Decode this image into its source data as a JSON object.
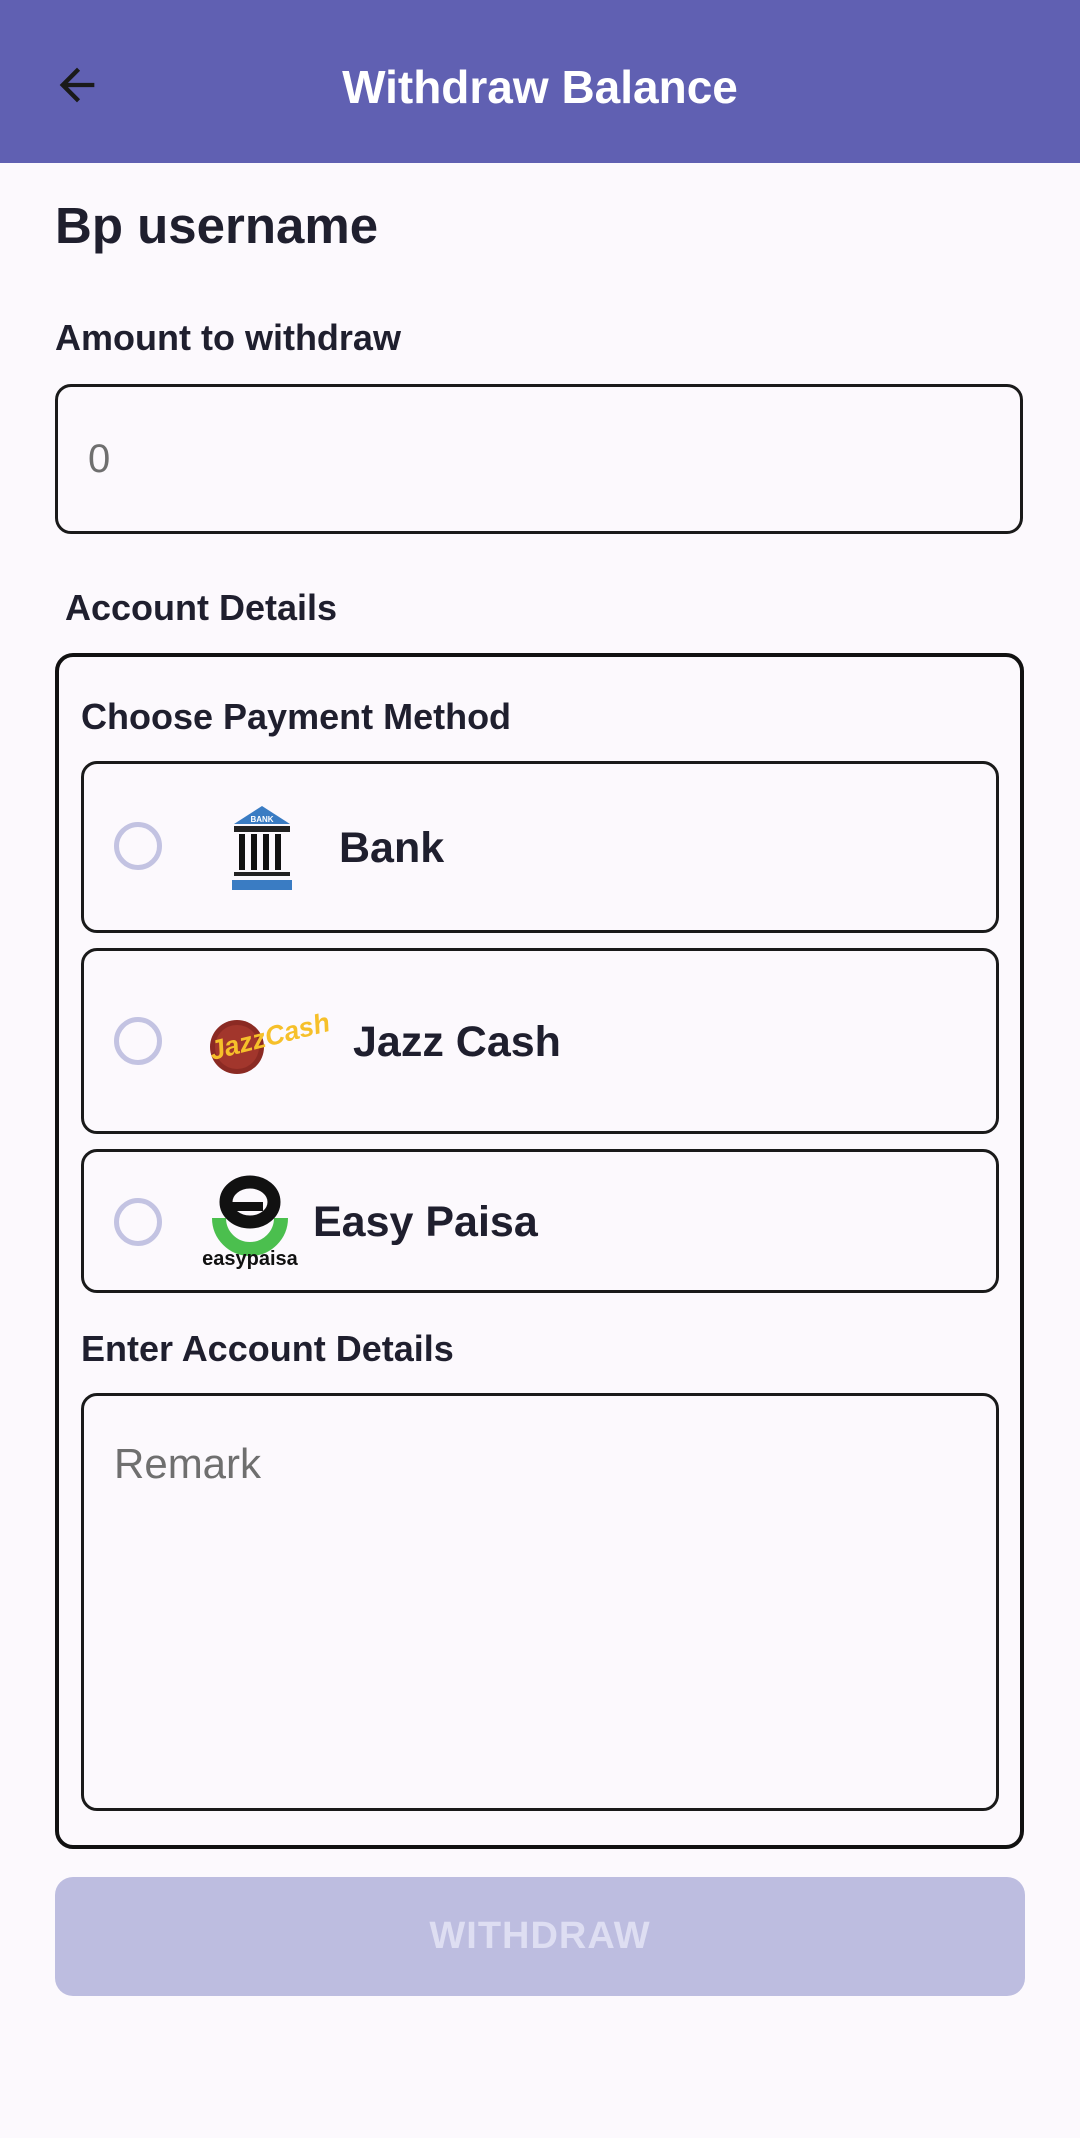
{
  "appbar": {
    "title": "Withdraw Balance",
    "back_icon": "arrow-left-icon",
    "color": "#6060b2"
  },
  "header": {
    "username": "Bp username"
  },
  "amount": {
    "label": "Amount to withdraw",
    "placeholder": "0"
  },
  "account": {
    "section_label": "Account Details",
    "choose_label": "Choose Payment Method",
    "methods": [
      {
        "label": "Bank",
        "icon": "bank-icon",
        "icon_text": "BANK",
        "selected": false
      },
      {
        "label": "Jazz Cash",
        "icon": "jazzcash-logo",
        "icon_text": "JazzCash",
        "selected": false
      },
      {
        "label": "Easy Paisa",
        "icon": "easypaisa-logo",
        "icon_text": "easypaisa",
        "selected": false
      }
    ],
    "details_label": "Enter Account Details",
    "remark_placeholder": "Remark"
  },
  "actions": {
    "withdraw_label": "WITHDRAW",
    "withdraw_enabled": false,
    "disabled_color": "#bdbde0"
  }
}
